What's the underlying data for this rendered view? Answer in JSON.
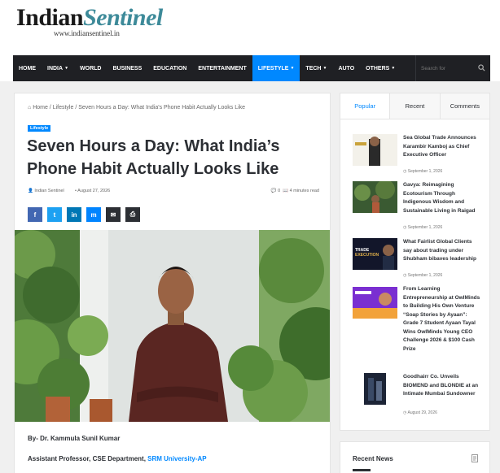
{
  "logo": {
    "part1": "Indian",
    "part2": "Sentinel",
    "url": "www.indiansentinel.in"
  },
  "nav": {
    "items": [
      {
        "label": "HOME",
        "dropdown": false
      },
      {
        "label": "INDIA",
        "dropdown": true
      },
      {
        "label": "WORLD",
        "dropdown": false
      },
      {
        "label": "BUSINESS",
        "dropdown": false
      },
      {
        "label": "EDUCATION",
        "dropdown": false
      },
      {
        "label": "ENTERTAINMENT",
        "dropdown": false
      },
      {
        "label": "LIFESTYLE",
        "dropdown": true,
        "active": true
      },
      {
        "label": "TECH",
        "dropdown": true
      },
      {
        "label": "AUTO",
        "dropdown": false
      },
      {
        "label": "OTHERS",
        "dropdown": true
      }
    ],
    "search_placeholder": "Search for",
    "active_color": "#0088ff"
  },
  "article": {
    "breadcrumb": "Home / Lifestyle / Seven Hours a Day: What India's Phone Habit Actually Looks Like",
    "category": "Lifestyle",
    "title": "Seven Hours a Day: What India’s Phone Habit Actually Looks Like",
    "author": "Indian Sentinel",
    "date": "August 27, 2026",
    "comments": "0",
    "read_time": "4 minutes read",
    "share": [
      {
        "icon": "facebook-icon",
        "glyph": "f",
        "color": "#4267b2"
      },
      {
        "icon": "twitter-icon",
        "glyph": "t",
        "color": "#1da1f2"
      },
      {
        "icon": "linkedin-icon",
        "glyph": "in",
        "color": "#0077b5"
      },
      {
        "icon": "messenger-icon",
        "glyph": "m",
        "color": "#0084ff"
      },
      {
        "icon": "email-icon",
        "glyph": "✉",
        "color": "#2c2f34"
      },
      {
        "icon": "print-icon",
        "glyph": "⎙",
        "color": "#2c2f34"
      }
    ],
    "byline": "By- Dr. Kammula Sunil Kumar",
    "role_text": "Assistant Professor,  CSE Department, ",
    "role_link": "SRM University-AP"
  },
  "sidebar": {
    "tabs": [
      "Popular",
      "Recent",
      "Comments"
    ],
    "posts": [
      {
        "title": "Sea Global Trade Announces Karambir Kamboj as Chief Executive Officer",
        "date": "September 1, 2026"
      },
      {
        "title": "Gavya: Reimagining Ecotourism Through Indigenous Wisdom and Sustainable Living in Raigad",
        "date": "September 1, 2026"
      },
      {
        "title": "What Fairlist Global Clients say about trading under Shubham bibaves leadership",
        "date": "September 1, 2026"
      },
      {
        "title": "From Learning Entrepreneurship at OwlMinds to Building His Own Venture “Soap Stories by Ayaan”: Grade 7 Student Ayaan Tayal Wins OwlMinds Young CEO Challenge 2026 & $100 Cash Prize",
        "date": "September 1, 2026"
      },
      {
        "title": "Goodhairr Co. Unveils BIOMEND and BLONDIE at an Intimate Mumbai Sundowner",
        "date": "August 29, 2026"
      }
    ],
    "recent_title": "Recent News"
  }
}
